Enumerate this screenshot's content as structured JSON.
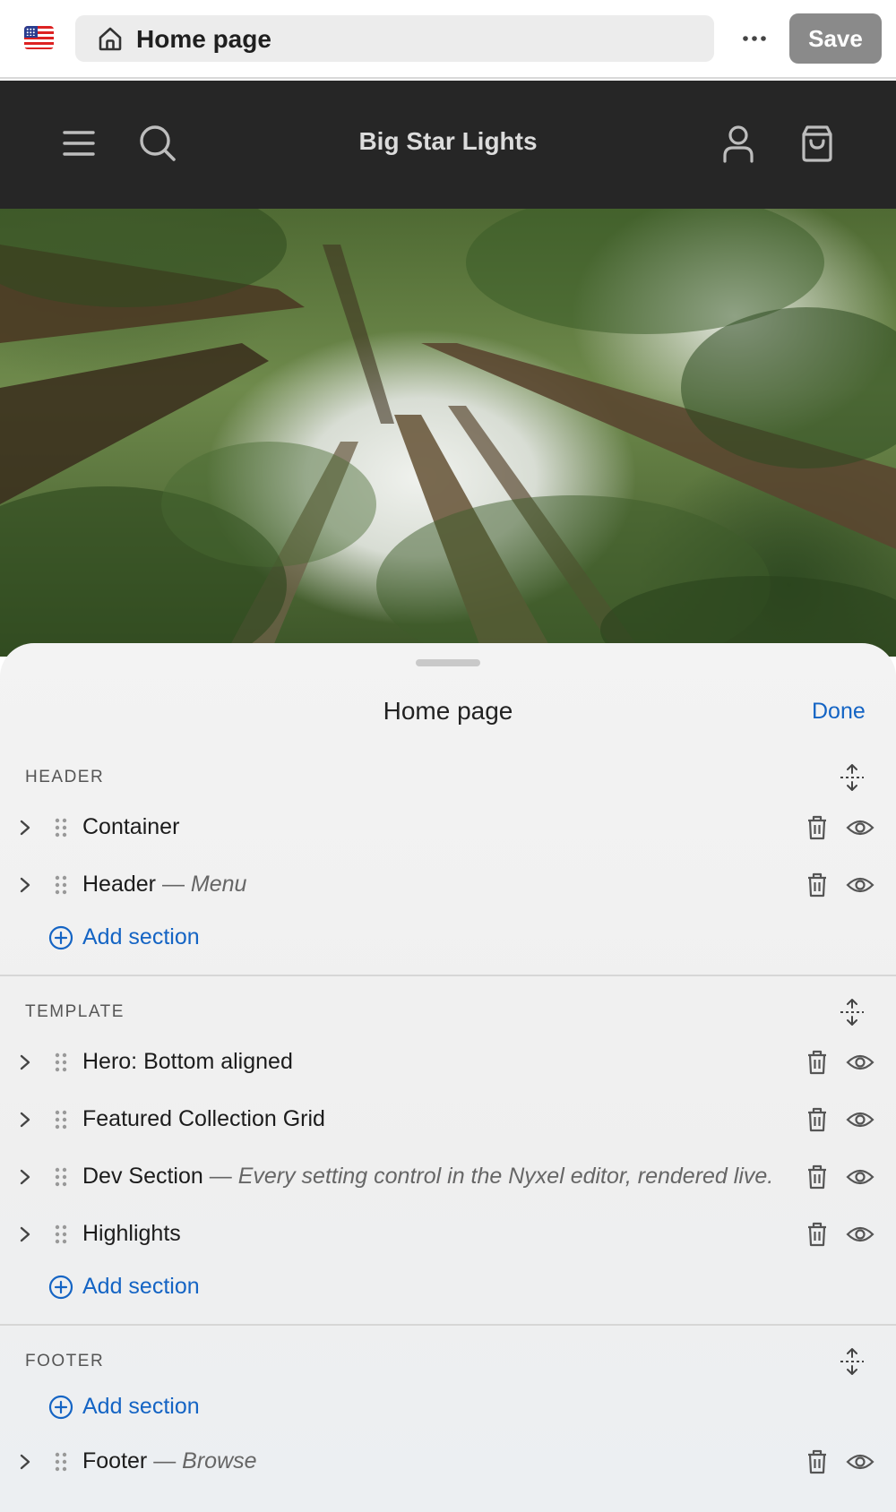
{
  "editor_bar": {
    "locale_icon": "us-flag-icon",
    "page_selector": {
      "icon": "home-icon",
      "label": "Home page"
    },
    "more_icon": "more-horizontal-icon",
    "save_label": "Save"
  },
  "store_header": {
    "menu_icon": "hamburger-menu-icon",
    "search_icon": "search-icon",
    "title": "Big Star Lights",
    "account_icon": "account-icon",
    "cart_icon": "shopping-bag-icon"
  },
  "hero": {
    "image": "forest-canopy-photo"
  },
  "sheet": {
    "title": "Home page",
    "done_label": "Done",
    "groups": [
      {
        "label": "HEADER",
        "sections": [
          {
            "name": "Container",
            "sep": "",
            "subtitle": ""
          },
          {
            "name": "Header",
            "sep": " — ",
            "subtitle": "Menu"
          }
        ],
        "add_label": "Add section"
      },
      {
        "label": "TEMPLATE",
        "sections": [
          {
            "name": "Hero: Bottom aligned",
            "sep": "",
            "subtitle": ""
          },
          {
            "name": "Featured Collection Grid",
            "sep": "",
            "subtitle": ""
          },
          {
            "name": "Dev Section",
            "sep": " — ",
            "subtitle": "Every setting control in the Nyxel editor, rendered live."
          },
          {
            "name": "Highlights",
            "sep": "",
            "subtitle": ""
          }
        ],
        "add_label": "Add section"
      },
      {
        "label": "FOOTER",
        "add_label": "Add section",
        "sections": [
          {
            "name": "Footer",
            "sep": " — ",
            "subtitle": "Browse"
          }
        ]
      }
    ]
  },
  "colors": {
    "accent": "#1464c4",
    "save_button_bg": "#8a8a8a",
    "store_header_bg": "#262626",
    "sheet_bg": "#f1f1f1"
  }
}
